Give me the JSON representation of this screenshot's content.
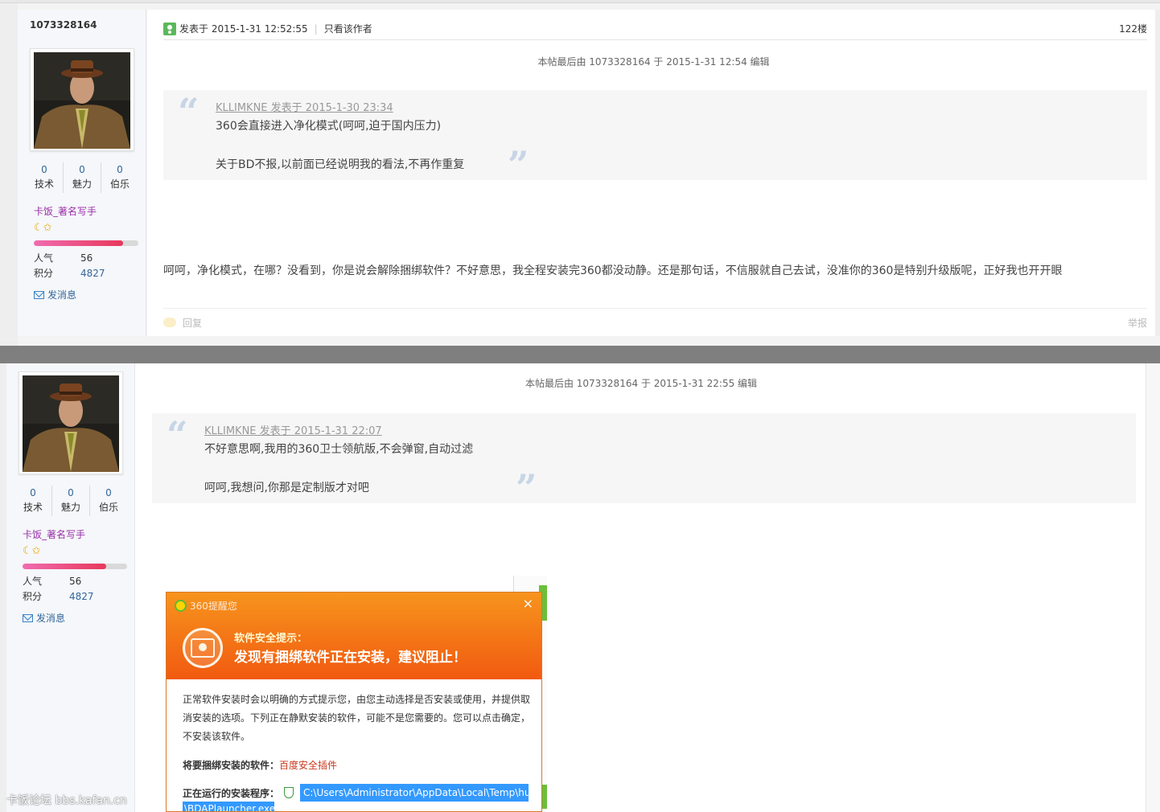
{
  "post1": {
    "author": {
      "username": "1073328164",
      "stats": [
        {
          "value": "0",
          "label": "技术"
        },
        {
          "value": "0",
          "label": "魅力"
        },
        {
          "value": "0",
          "label": "伯乐"
        }
      ],
      "usergroup": "卡饭_著名写手",
      "medals": "☾✩",
      "progress": 0.85,
      "popularity_label": "人气",
      "popularity_value": "56",
      "points_label": "积分",
      "points_value": "4827",
      "send_message": "发消息"
    },
    "header": {
      "posted_at": "发表于 2015-1-31 12:52:55",
      "only_author": "只看该作者",
      "floor": "122楼"
    },
    "edit_note": "本帖最后由 1073328164 于 2015-1-31 12:54 编辑",
    "quote": {
      "source": "KLLIMKNE 发表于 2015-1-30 23:34",
      "line1": "360会直接进入净化模式(呵呵,迫于国内压力)",
      "line2": "关于BD不报,以前面已经说明我的看法,不再作重复"
    },
    "body": "呵呵，净化模式，在哪？没看到，你是说会解除捆绑软件？不好意思，我全程安装完360都没动静。还是那句话，不信服就自己去试，没准你的360是特别升级版呢，正好我也开开眼",
    "footer": {
      "reply": "回复",
      "report": "举报"
    }
  },
  "post2": {
    "author": {
      "stats": [
        {
          "value": "0",
          "label": "技术"
        },
        {
          "value": "0",
          "label": "魅力"
        },
        {
          "value": "0",
          "label": "伯乐"
        }
      ],
      "usergroup": "卡饭_著名写手",
      "medals": "☾✩",
      "progress": 0.8,
      "popularity_label": "人气",
      "popularity_value": "56",
      "points_label": "积分",
      "points_value": "4827",
      "send_message": "发消息"
    },
    "edit_note": "本帖最后由 1073328164 于 2015-1-31 22:55 编辑",
    "quote": {
      "source": "KLLIMKNE 发表于 2015-1-31 22:07",
      "line1": "不好意思啊,我用的360卫士领航版,不会弹窗,自动过滤",
      "line2": "呵呵,我想问,你那是定制版才对吧"
    }
  },
  "popup": {
    "title": "360提醒您",
    "close": "×",
    "heading_small": "软件安全提示：",
    "heading_large": "发现有捆绑软件正在安装，建议阻止！",
    "description": "正常软件安装时会以明确的方式提示您，由您主动选择是否安装或使用，并提供取消安装的选项。下列正在静默安装的软件，可能不是您需要的。您可以点击确定，不安装该软件。",
    "bundled_label": "将要捆绑安装的软件：",
    "bundled_value": "百度安全插件",
    "running_label": "正在运行的安装程序：",
    "running_path": "C:\\Users\\Administrator\\AppData\\Local\\Temp\\hu",
    "running_path2": "\\BDAPlauncher.exe"
  },
  "watermark": "卡饭论坛 bbs.kafan.cn",
  "colors": {
    "link_blue": "#336699",
    "usergroup_purple": "#9b30a8",
    "popup_orange": "#f7941d"
  }
}
